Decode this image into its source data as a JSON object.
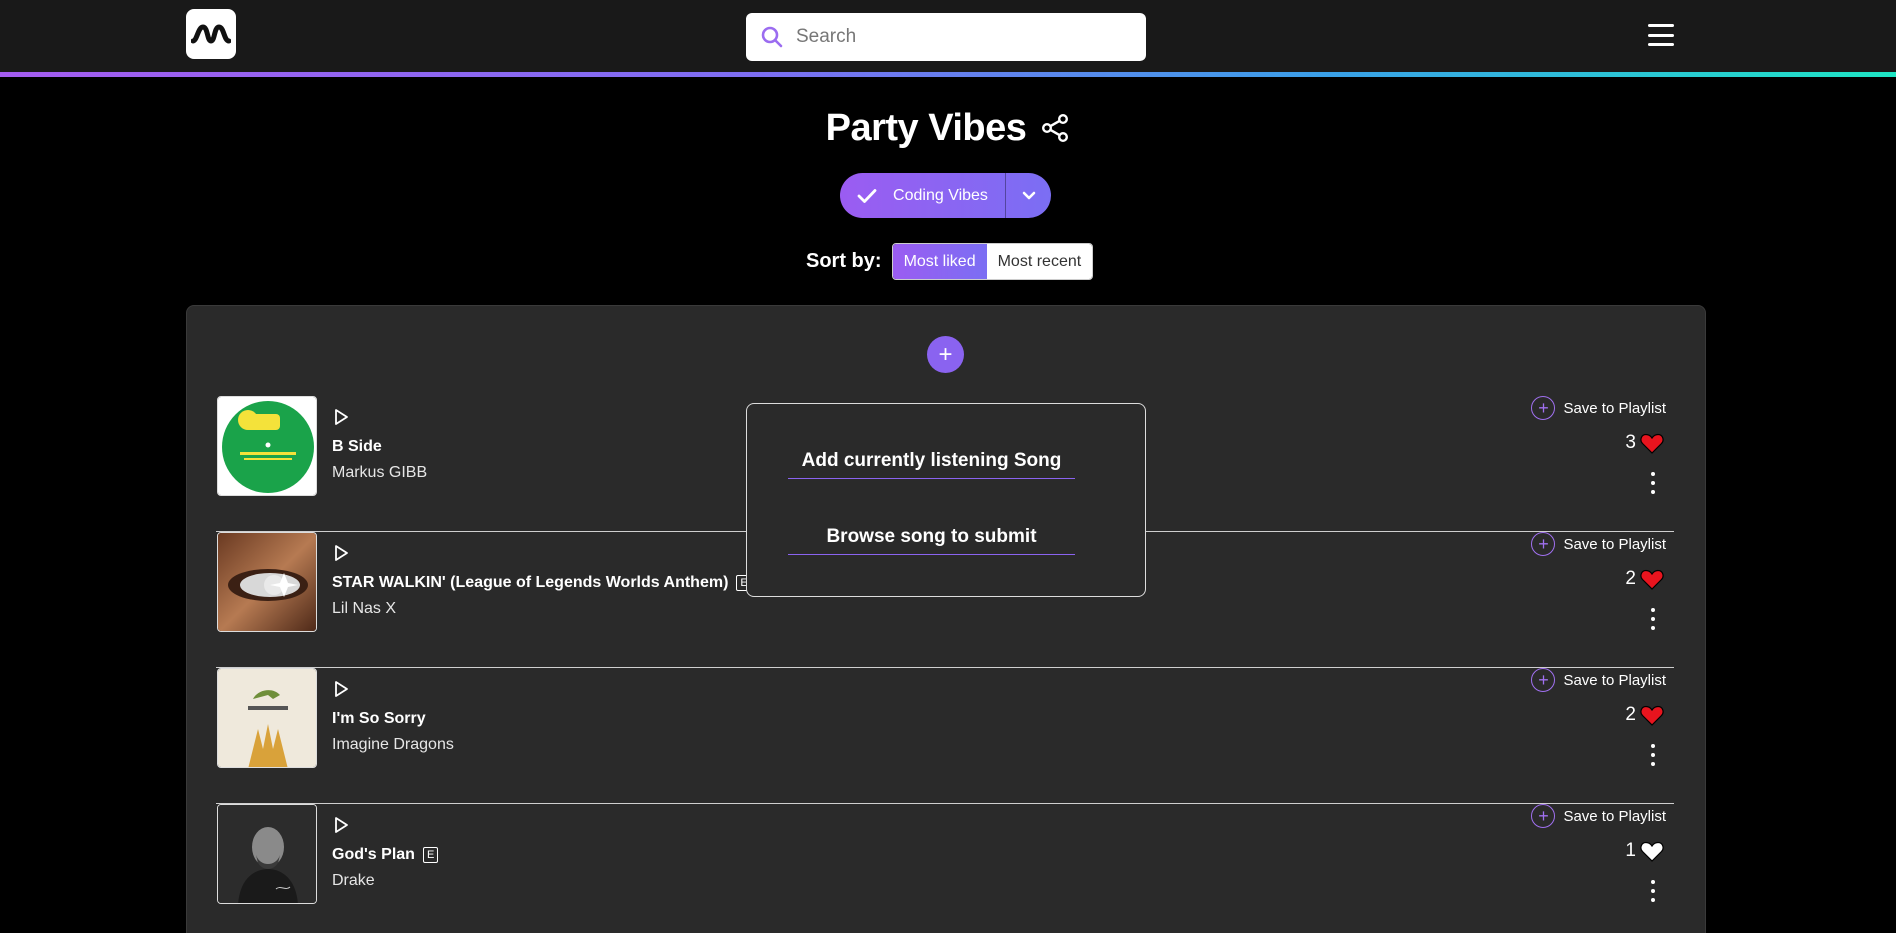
{
  "header": {
    "logo_icon": "waveform-logo-icon",
    "search_placeholder": "Search",
    "menu_icon": "hamburger-menu-icon"
  },
  "page": {
    "title": "Party Vibes",
    "share_icon": "share-icon"
  },
  "playlist_selector": {
    "selected": "Coding Vibes",
    "check_icon": "check-icon",
    "toggle_icon": "chevron-down-icon"
  },
  "sort": {
    "label": "Sort by:",
    "options": [
      "Most liked",
      "Most recent"
    ],
    "active": "Most liked"
  },
  "add_button": {
    "label": "+"
  },
  "popup": {
    "items": [
      "Add currently listening Song",
      "Browse song to submit"
    ]
  },
  "songs": [
    {
      "title": "B Side",
      "artist": "Markus GIBB",
      "explicit": false,
      "likes": "3",
      "liked": true,
      "save_label": "Save to Playlist"
    },
    {
      "title": "STAR WALKIN' (League of Legends Worlds Anthem)",
      "artist": "Lil Nas X",
      "explicit": true,
      "likes": "2",
      "liked": true,
      "save_label": "Save to Playlist"
    },
    {
      "title": "I'm So Sorry",
      "artist": "Imagine Dragons",
      "explicit": false,
      "likes": "2",
      "liked": true,
      "save_label": "Save to Playlist"
    },
    {
      "title": "God's Plan",
      "artist": "Drake",
      "explicit": true,
      "likes": "1",
      "liked": false,
      "save_label": "Save to Playlist"
    }
  ],
  "explicit_label": "E",
  "colors": {
    "accent": "#8a63f0",
    "heart_liked": "#e8141e",
    "heart_unliked": "#ffffff",
    "background": "#000000",
    "panel": "#2a2a2a"
  }
}
